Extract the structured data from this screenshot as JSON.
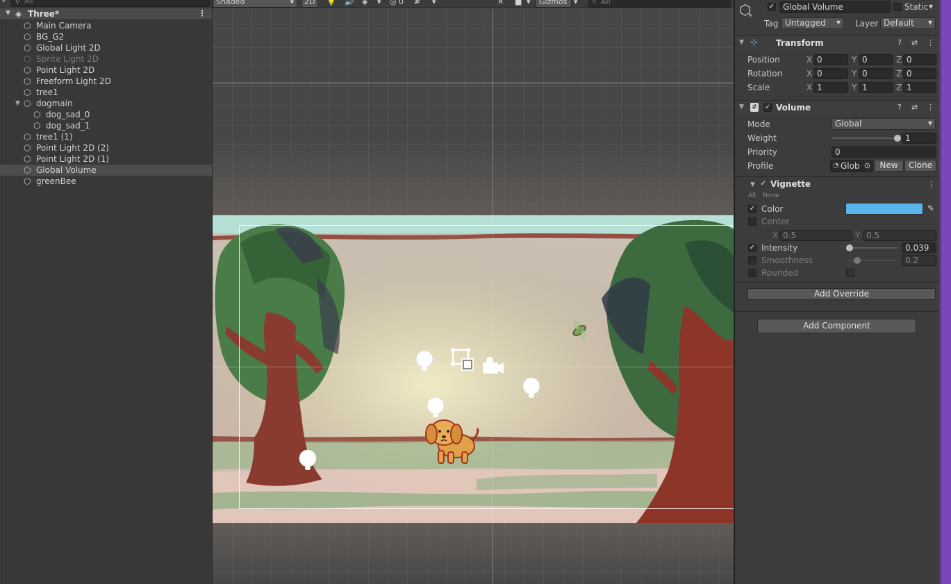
{
  "hierarchy": {
    "search_placeholder": "All",
    "scene_name": "Three*",
    "items": [
      {
        "label": "Main Camera"
      },
      {
        "label": "BG_G2"
      },
      {
        "label": "Global Light 2D"
      },
      {
        "label": "Sprite Light 2D"
      },
      {
        "label": "Point Light 2D"
      },
      {
        "label": "Freeform Light 2D"
      },
      {
        "label": "tree1"
      },
      {
        "label": "dogmain"
      },
      {
        "label": "dog_sad_0"
      },
      {
        "label": "dog_sad_1"
      },
      {
        "label": "tree1 (1)"
      },
      {
        "label": "Point Light 2D (2)"
      },
      {
        "label": "Point Light 2D (1)"
      },
      {
        "label": "Global Volume"
      },
      {
        "label": "greenBee"
      }
    ],
    "selected": "Global Volume",
    "disabled": "Sprite Light 2D"
  },
  "scene_toolbar": {
    "draw_mode": "Shaded",
    "mode_2d": "2D",
    "hidden_count": "0",
    "gizmos_label": "Gizmos",
    "search_placeholder": "All"
  },
  "inspector": {
    "object_name": "Global Volume",
    "active": true,
    "static_label": "Static",
    "tag_label": "Tag",
    "tag_value": "Untagged",
    "layer_label": "Layer",
    "layer_value": "Default",
    "transform": {
      "title": "Transform",
      "position_label": "Position",
      "rotation_label": "Rotation",
      "scale_label": "Scale",
      "axis_x": "X",
      "axis_y": "Y",
      "axis_z": "Z",
      "position": {
        "x": "0",
        "y": "0",
        "z": "0"
      },
      "rotation": {
        "x": "0",
        "y": "0",
        "z": "0"
      },
      "scale": {
        "x": "1",
        "y": "1",
        "z": "1"
      }
    },
    "volume": {
      "title": "Volume",
      "mode_label": "Mode",
      "mode_value": "Global",
      "weight_label": "Weight",
      "weight_value": "1",
      "weight_fraction": 1,
      "priority_label": "Priority",
      "priority_value": "0",
      "profile_label": "Profile",
      "profile_value": "Glob",
      "new_label": "New",
      "clone_label": "Clone"
    },
    "vignette": {
      "title": "Vignette",
      "all_label": "All",
      "none_label": "None",
      "color_label": "Color",
      "color_value": "#5ab6ea",
      "center_label": "Center",
      "center_x_label": "X",
      "center_x": "0.5",
      "center_y_label": "Y",
      "center_y": "0.5",
      "intensity_label": "Intensity",
      "intensity_value": "0.039",
      "intensity_fraction": 0.039,
      "smoothness_label": "Smoothness",
      "smoothness_value": "0.2",
      "smoothness_fraction": 0.2,
      "rounded_label": "Rounded"
    },
    "add_override_label": "Add Override",
    "add_component_label": "Add Component"
  }
}
